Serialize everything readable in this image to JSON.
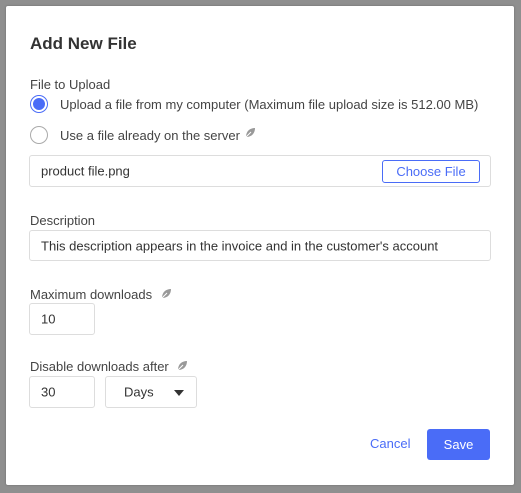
{
  "dialog": {
    "title": "Add New File"
  },
  "file_to_upload": {
    "label": "File to Upload",
    "options": [
      {
        "label": "Upload a file from my computer (Maximum file upload size is 512.00 MB)",
        "selected": true
      },
      {
        "label": "Use a file already on the server",
        "selected": false
      }
    ],
    "file_name": "product file.png",
    "choose_button": "Choose File"
  },
  "description": {
    "label": "Description",
    "value": "This description appears in the invoice and in the customer's account"
  },
  "max_downloads": {
    "label": "Maximum downloads",
    "value": "10"
  },
  "disable_after": {
    "label": "Disable downloads after",
    "value": "30",
    "unit": "Days"
  },
  "actions": {
    "cancel": "Cancel",
    "save": "Save"
  },
  "colors": {
    "accent": "#4a6cf7",
    "overlay": "#8f8f8f"
  }
}
